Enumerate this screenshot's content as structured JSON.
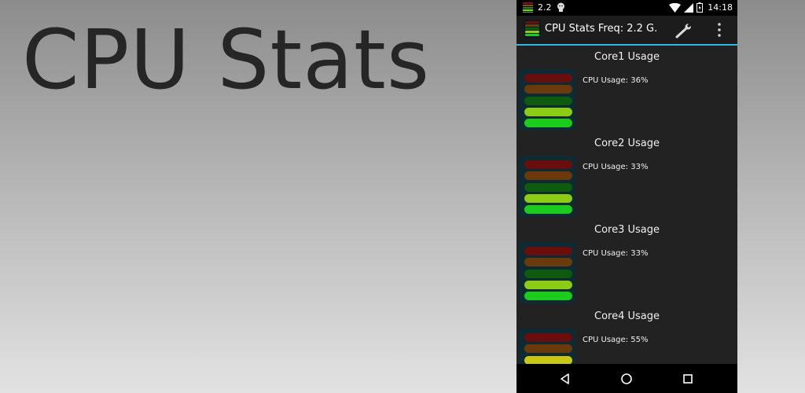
{
  "promo": {
    "title": "CPU Stats"
  },
  "status_bar": {
    "left_text": "2.2",
    "time": "14:18",
    "icons": [
      "cpu-meter-icon",
      "android-icon",
      "wifi-icon",
      "signal-icon",
      "battery-charging-icon"
    ]
  },
  "action_bar": {
    "title": "CPU Stats  Freq: 2.2 G.",
    "icons": [
      "app-icon",
      "wrench-icon",
      "overflow-menu-icon"
    ]
  },
  "cores": [
    {
      "title": "Core1 Usage",
      "usage_text": "CPU Usage: 36%",
      "usage": 36
    },
    {
      "title": "Core2 Usage",
      "usage_text": "CPU Usage: 33%",
      "usage": 33
    },
    {
      "title": "Core3 Usage",
      "usage_text": "CPU Usage: 33%",
      "usage": 33
    },
    {
      "title": "Core4 Usage",
      "usage_text": "CPU Usage: 55%",
      "usage": 55
    }
  ],
  "navigation": {
    "icons": [
      "back-icon",
      "home-icon",
      "recents-icon"
    ]
  },
  "colors": {
    "accent": "#33b5e5",
    "bar_red": "#6a0d0d",
    "bar_brown": "#6b3a0c",
    "bar_dark_green": "#0e5a0e",
    "bar_lime": "#8ccc14",
    "bar_green": "#1ccc1c",
    "bar_yellow": "#c8c814"
  }
}
